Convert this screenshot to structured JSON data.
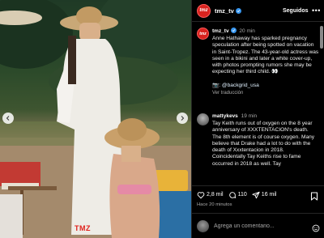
{
  "post": {
    "username": "tmz_tv",
    "avatar_text": "tmz",
    "follow_label": "Seguidos",
    "more_label": "•••",
    "time": "20 min",
    "caption": "Anne Hathaway has sparked pregnancy speculation after being spotted on vacation in Saint-Tropez. The 43-year-old actress was seen in a bikini and later a white cover-up, with photos prompting rumors she may be expecting her third child. 👀",
    "credit_prefix": "📷: ",
    "credit_handle": "@backgrid_usa",
    "translate_label": "Ver traducción",
    "watermark": "TMZ"
  },
  "comment": {
    "username": "mattykevs",
    "time": "19 min",
    "text": "Tay Keith runs out of oxygen on the 8 year anniversary of XXXTENTACION's death. The 8th element is of course oxygen. Many believe that Drake had a lot to do with the death of Xxxtentacion in 2018. Coincidentally Tay Keiths rise to fame occurred in 2018 as well. Tay"
  },
  "actions": {
    "likes": "2,8 mil",
    "comments": "110",
    "shares": "16 mil",
    "posted_ago": "Hace 20 minutos"
  },
  "comment_box": {
    "placeholder": "Agrega un comentario..."
  },
  "colors": {
    "background": "#000000",
    "brand_red": "#d8231f",
    "verified": "#3897f0",
    "muted_text": "#a8a8a8"
  }
}
